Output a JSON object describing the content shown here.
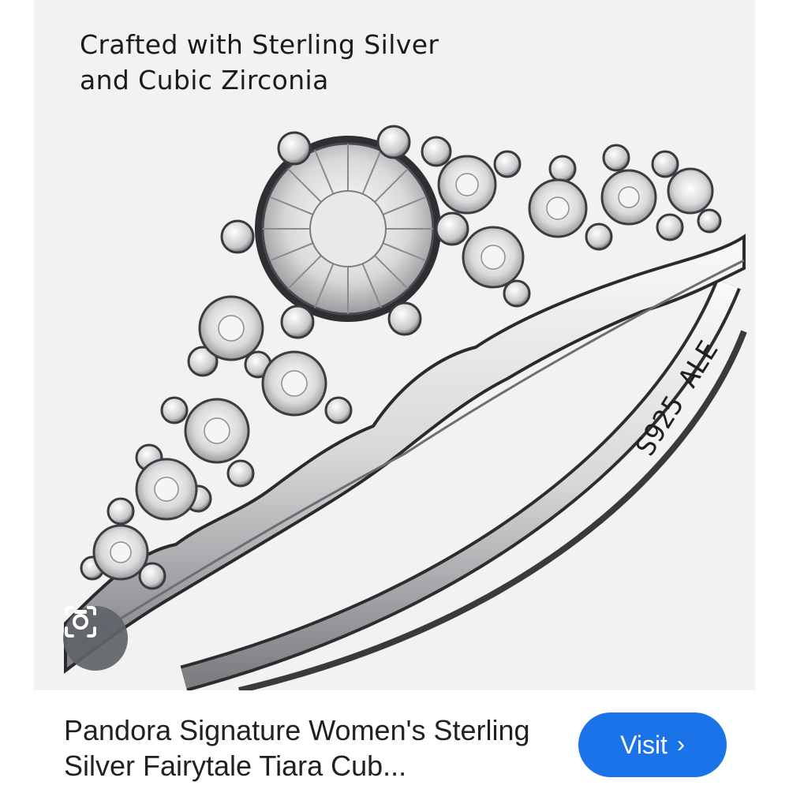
{
  "image": {
    "caption_line1": "Crafted with Sterling Silver",
    "caption_line2": "and Cubic Zirconia",
    "engraving": "S925 ALE",
    "lens_icon": "camera-lens-icon"
  },
  "result": {
    "title": "Pandora Signature Women's Sterling Silver Fairytale Tiara Cub...",
    "visit_label": "Visit",
    "visit_icon": "chevron-right-icon"
  },
  "colors": {
    "accent": "#1a73e8",
    "background": "#f2f2f3",
    "lens_button": "#5f6368"
  }
}
